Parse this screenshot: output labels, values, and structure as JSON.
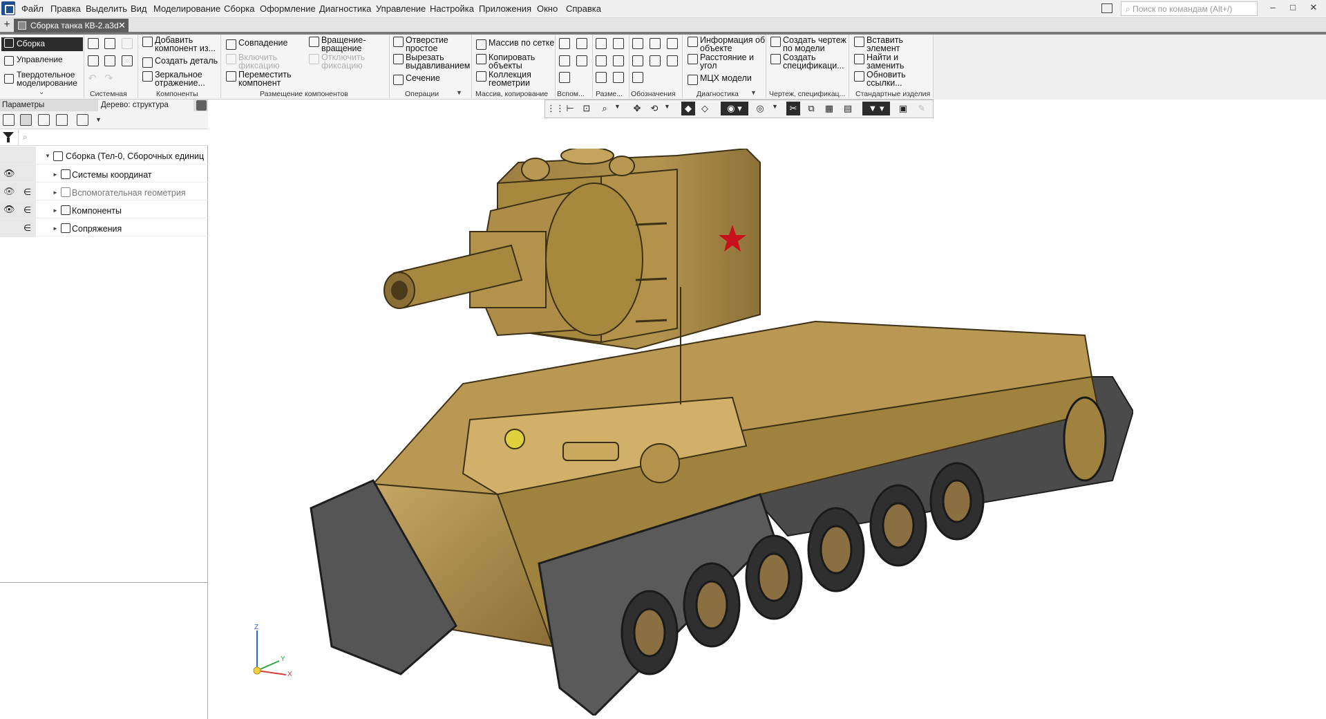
{
  "menu": {
    "items": [
      "Файл",
      "Правка",
      "Выделить",
      "Вид",
      "Моделирование",
      "Сборка",
      "Оформление",
      "Диагностика",
      "Управление",
      "Настройка",
      "Приложения",
      "Окно",
      "Справка"
    ],
    "search_placeholder": "Поиск по командам (Alt+/)",
    "window_buttons": [
      "–",
      "□",
      "✕"
    ]
  },
  "document_tab": {
    "title": "Сборка танка КВ-2.a3d",
    "close": "✕",
    "new_tab": "+"
  },
  "modes": {
    "assembly": "Сборка",
    "management": "Управление",
    "solid_line1": "Твердотельное",
    "solid_line2": "моделирование",
    "more": "⌄"
  },
  "ribbon": {
    "components": {
      "add_line1": "Добавить",
      "add_line2": "компонент из...",
      "create_part": "Создать деталь",
      "mirror_line1": "Зеркальное",
      "mirror_line2": "отражение..."
    },
    "placement": {
      "coincidence": "Совпадение",
      "enable_fix_line1": "Включить",
      "enable_fix_line2": "фиксацию",
      "move_line1": "Переместить",
      "move_line2": "компонент",
      "rotate_line1": "Вращение-",
      "rotate_line2": "вращение",
      "disable_fix_line1": "Отключить",
      "disable_fix_line2": "фиксацию"
    },
    "operations": {
      "hole_line1": "Отверстие",
      "hole_line2": "простое",
      "cut_line1": "Вырезать",
      "cut_line2": "выдавливанием",
      "section": "Сечение"
    },
    "array": {
      "grid": "Массив по сетке",
      "copy_line1": "Копировать",
      "copy_line2": "объекты",
      "collection_line1": "Коллекция",
      "collection_line2": "геометрии"
    },
    "diagnostics": {
      "info_line1": "Информация об",
      "info_line2": "объекте",
      "distance_line1": "Расстояние и",
      "distance_line2": "угол",
      "mass": "МЦХ модели"
    },
    "drawing": {
      "create_drawing_line1": "Создать чертеж",
      "create_drawing_line2": "по модели",
      "create_spec_line1": "Создать",
      "create_spec_line2": "спецификаци..."
    },
    "standard": {
      "insert_line1": "Вставить",
      "insert_line2": "элемент",
      "find_line1": "Найти и",
      "find_line2": "заменить",
      "refresh_line1": "Обновить",
      "refresh_line2": "ссылки..."
    },
    "groups": {
      "system": "Системная",
      "components": "Компоненты",
      "placement": "Размещение компонентов",
      "operations": "Операции",
      "array": "Массив, копирование",
      "aux": "Вспом...",
      "dims": "Разме...",
      "designations": "Обозначения",
      "diagnostics": "Диагностика",
      "drawing": "Чертеж, спецификац...",
      "standard": "Стандартные изделия"
    }
  },
  "left_panel": {
    "params_label": "Параметры",
    "tree_tab": "Дерево: структура",
    "search_placeholder": "⌕",
    "tree": {
      "root": "Сборка (Тел-0, Сборочных единиц",
      "coords": "Системы координат",
      "aux_geom": "Вспомогательная геометрия",
      "components": "Компоненты",
      "mates": "Сопряжения"
    }
  },
  "view_toolbar_icons": [
    "grid",
    "axes",
    "orient",
    "zoom",
    "pan",
    "rotate",
    "shaded",
    "wireframe",
    "hide",
    "visibility",
    "section",
    "explode",
    "filter",
    "settings"
  ],
  "triad": {
    "z": "Z",
    "y": "Y",
    "x": "X"
  },
  "colors": {
    "model_body": "#a8894a",
    "model_light": "#c9aa66",
    "model_dark": "#5e4b25",
    "star": "#c8101a",
    "dark_button": "#2b2b2b",
    "accent_bar": "#7a7a7a"
  }
}
